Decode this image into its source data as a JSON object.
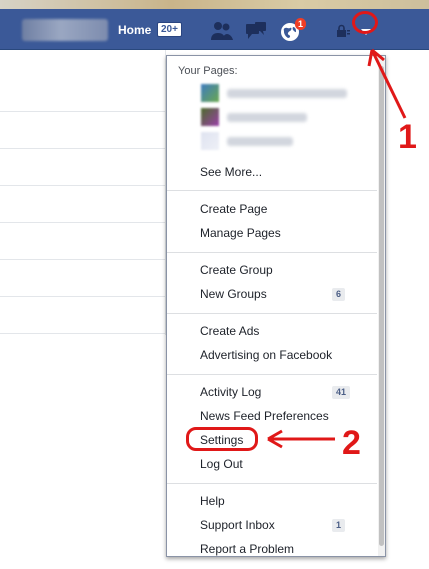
{
  "topbar": {
    "home_label": "Home",
    "home_count": "20+",
    "notifications_count": "1",
    "icons": [
      "friend-requests-icon",
      "messages-icon",
      "notifications-globe-icon",
      "privacy-lock-icon",
      "menu-triangle-icon"
    ],
    "bar_color": "#3b5998"
  },
  "dropdown": {
    "your_pages_title": "Your Pages:",
    "see_more": "See More...",
    "create_page": "Create Page",
    "manage_pages": "Manage Pages",
    "create_group": "Create Group",
    "new_groups": "New Groups",
    "new_groups_count": "6",
    "create_ads": "Create Ads",
    "advertising": "Advertising on Facebook",
    "activity_log": "Activity Log",
    "activity_log_count": "41",
    "news_feed_prefs": "News Feed Preferences",
    "settings": "Settings",
    "log_out": "Log Out",
    "help": "Help",
    "support_inbox": "Support Inbox",
    "support_inbox_count": "1",
    "report_problem": "Report a Problem"
  },
  "annotations": {
    "step1": "1",
    "step2": "2",
    "color": "#e01818"
  }
}
